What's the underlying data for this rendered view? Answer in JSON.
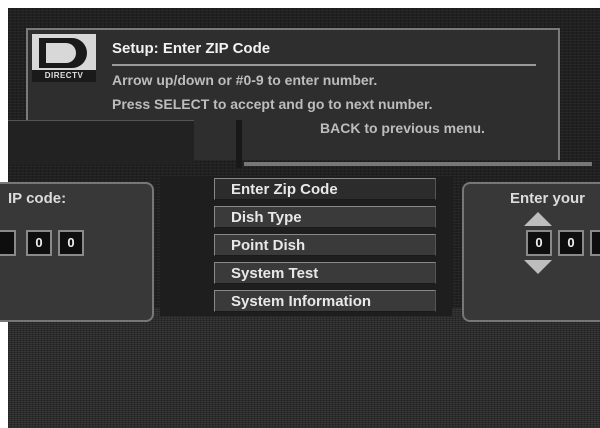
{
  "header": {
    "logo_text": "DIRECTV",
    "title": "Setup: Enter ZIP Code",
    "instructions": [
      "Arrow up/down or #0-9 to enter number.",
      "Press SELECT to accept and go to next number.",
      "BACK to previous menu."
    ]
  },
  "menu": {
    "items": [
      {
        "label": "Enter Zip Code"
      },
      {
        "label": "Dish Type"
      },
      {
        "label": "Point Dish"
      },
      {
        "label": "System Test"
      },
      {
        "label": "System Information"
      }
    ]
  },
  "left_panel": {
    "label": "IP code:",
    "digits": [
      "",
      "0",
      "0"
    ]
  },
  "right_panel": {
    "label": "Enter your",
    "digits": [
      "0",
      "0",
      ""
    ]
  },
  "colors": {
    "background": "#202020",
    "panel": "#383838",
    "text": "#e8e8e8",
    "instruction_text": "#bdbdbd"
  },
  "icons": [
    "directv-logo",
    "arrow-up-icon",
    "arrow-down-icon"
  ]
}
